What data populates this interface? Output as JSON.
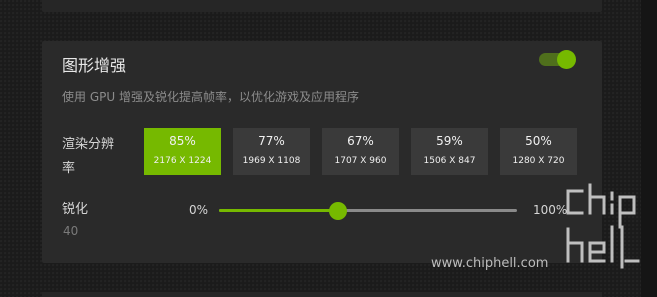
{
  "panel": {
    "title": "图形增强",
    "toggle_on": true,
    "subtitle": "使用 GPU 增强及锐化提高帧率，以优化游戏及应用程序"
  },
  "resolution": {
    "label": "渲染分辨率",
    "options": [
      {
        "percent": "85%",
        "dims": "2176 X 1224",
        "selected": true
      },
      {
        "percent": "77%",
        "dims": "1969 X 1108",
        "selected": false
      },
      {
        "percent": "67%",
        "dims": "1707 X 960",
        "selected": false
      },
      {
        "percent": "59%",
        "dims": "1506 X 847",
        "selected": false
      },
      {
        "percent": "50%",
        "dims": "1280 X 720",
        "selected": false
      }
    ]
  },
  "sharpen": {
    "label": "锐化",
    "value": "40",
    "min_label": "0%",
    "max_label": "100%",
    "level_fraction": 0.4
  },
  "watermark": {
    "text": "www.chiphell.com",
    "logo": "chiphell-logo"
  },
  "colors": {
    "accent": "#76b900",
    "panel_bg": "#2a2a2a",
    "button_bg": "#3a3a3a"
  }
}
